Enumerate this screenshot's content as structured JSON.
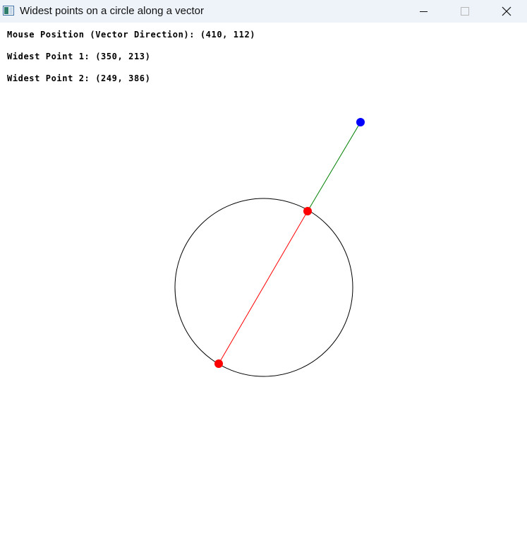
{
  "window": {
    "title": "Widest points on a circle along a vector",
    "icon": "app-window-icon",
    "controls": [
      "minimize-icon",
      "maximize-icon",
      "close-icon"
    ]
  },
  "info": {
    "mouse_position": "Mouse Position (Vector Direction): (410, 112)",
    "widest_point_1": "Widest Point 1: (350, 213)",
    "widest_point_2": "Widest Point 2: (249, 386)"
  },
  "scene": {
    "circle_color": "#000000",
    "mouse_point_color": "#0000ff",
    "widest_point_color": "#ff0000",
    "vector_line_color": "#008000",
    "diameter_line_color": "#ff0000"
  }
}
